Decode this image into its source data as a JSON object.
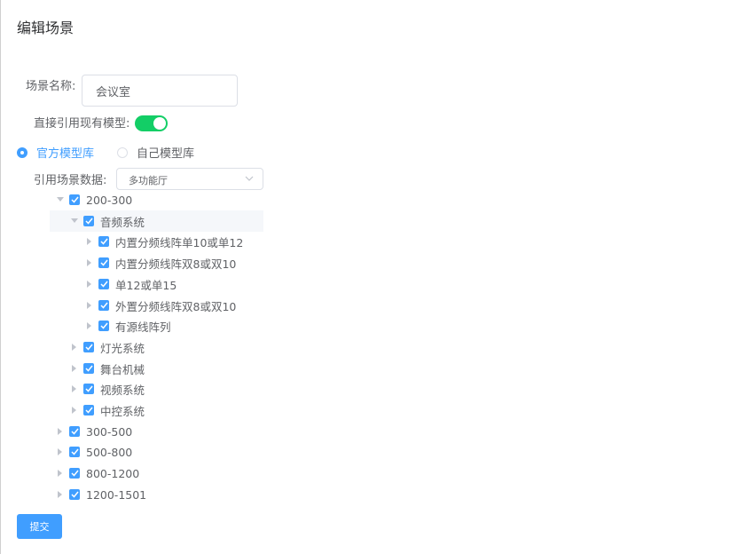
{
  "dialog": {
    "title": "编辑场景"
  },
  "form": {
    "scene_name_label": "场景名称:",
    "scene_name_value": "会议室",
    "use_model_label": "直接引用现有模型:",
    "use_model_enabled": true,
    "library_options": [
      {
        "label": "官方模型库",
        "checked": true
      },
      {
        "label": "自己模型库",
        "checked": false
      }
    ],
    "scene_data_label": "引用场景数据:",
    "scene_data_value": "多功能厅",
    "submit_label": "提交"
  },
  "tree": [
    {
      "label": "200-300",
      "level": 0,
      "expanded": true,
      "checked": true
    },
    {
      "label": "音频系统",
      "level": 1,
      "expanded": true,
      "checked": true,
      "highlighted": true
    },
    {
      "label": "内置分频线阵单10或单12",
      "level": 2,
      "expanded": false,
      "checked": true
    },
    {
      "label": "内置分频线阵双8或双10",
      "level": 2,
      "expanded": false,
      "checked": true
    },
    {
      "label": "单12或单15",
      "level": 2,
      "expanded": false,
      "checked": true
    },
    {
      "label": "外置分频线阵双8或双10",
      "level": 2,
      "expanded": false,
      "checked": true
    },
    {
      "label": "有源线阵列",
      "level": 2,
      "expanded": false,
      "checked": true
    },
    {
      "label": "灯光系统",
      "level": 1,
      "expanded": false,
      "checked": true
    },
    {
      "label": "舞台机械",
      "level": 1,
      "expanded": false,
      "checked": true
    },
    {
      "label": "视频系统",
      "level": 1,
      "expanded": false,
      "checked": true
    },
    {
      "label": "中控系统",
      "level": 1,
      "expanded": false,
      "checked": true
    },
    {
      "label": "300-500",
      "level": 0,
      "expanded": false,
      "checked": true
    },
    {
      "label": "500-800",
      "level": 0,
      "expanded": false,
      "checked": true
    },
    {
      "label": "800-1200",
      "level": 0,
      "expanded": false,
      "checked": true
    },
    {
      "label": "1200-1501",
      "level": 0,
      "expanded": false,
      "checked": true
    }
  ],
  "colors": {
    "primary": "#409eff",
    "switch_on": "#13ce66",
    "text": "#606266",
    "title": "#303133"
  }
}
